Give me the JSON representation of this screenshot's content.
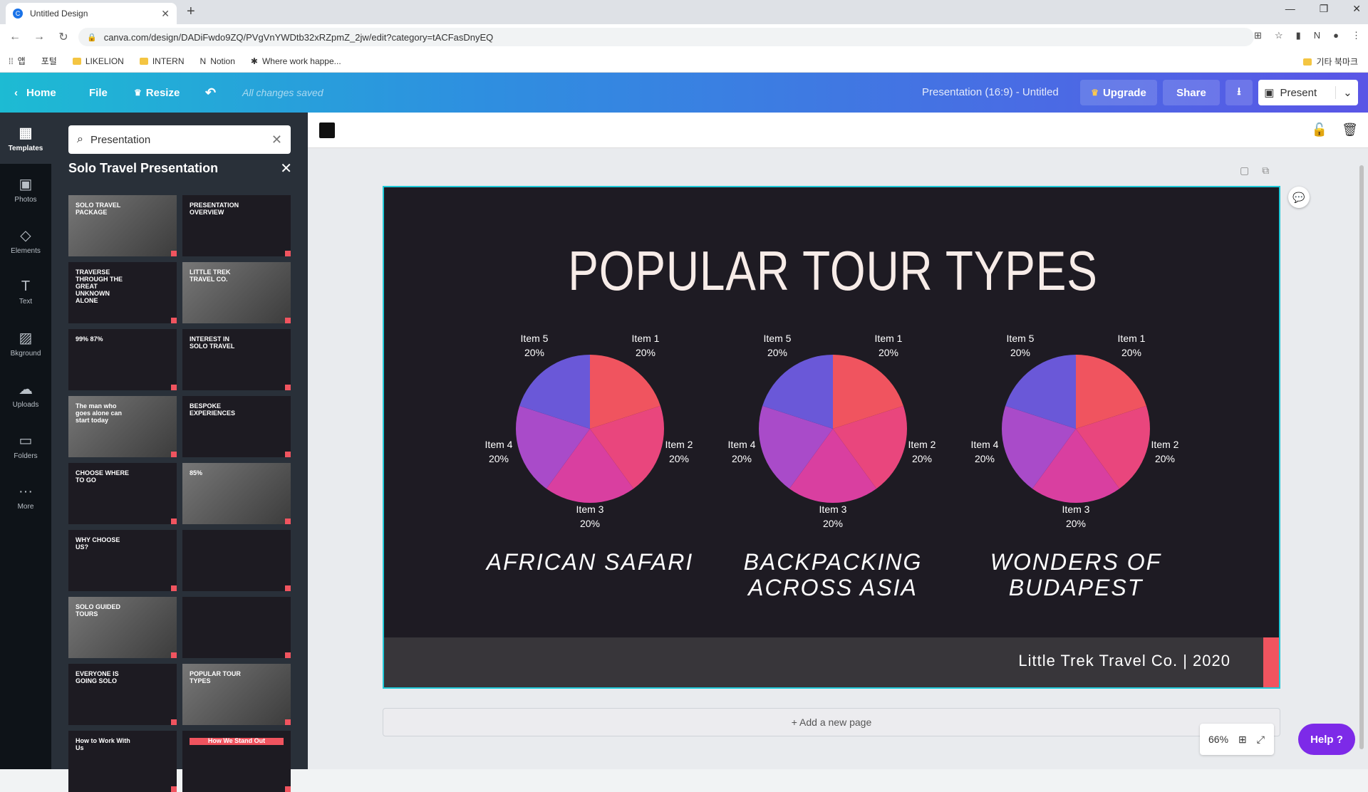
{
  "browser": {
    "tab_title": "Untitled Design",
    "url": "canva.com/design/DADiFwdo9ZQ/PVgVnYWDtb32xRZpmZ_2jw/edit?category=tACFasDnyEQ",
    "bookmarks": [
      "LIKELION",
      "INTERN",
      "Notion",
      "Where work happe..."
    ],
    "bookmark_prefix": [
      "앱",
      "포털"
    ],
    "other_bookmarks": "기타 북마크"
  },
  "topbar": {
    "home": "Home",
    "file": "File",
    "resize": "Resize",
    "saved": "All changes saved",
    "doc_title": "Presentation (16:9) - Untitled",
    "upgrade": "Upgrade",
    "share": "Share",
    "present": "Present"
  },
  "rail": [
    {
      "label": "Templates",
      "icon": "templates-icon"
    },
    {
      "label": "Photos",
      "icon": "photos-icon"
    },
    {
      "label": "Elements",
      "icon": "elements-icon"
    },
    {
      "label": "Text",
      "icon": "text-icon"
    },
    {
      "label": "Bkground",
      "icon": "background-icon"
    },
    {
      "label": "Uploads",
      "icon": "uploads-icon"
    },
    {
      "label": "Folders",
      "icon": "folders-icon"
    },
    {
      "label": "More",
      "icon": "more-icon"
    }
  ],
  "panel": {
    "search_value": "Presentation",
    "title": "Solo Travel Presentation",
    "thumbs": [
      {
        "label": "SOLO TRAVEL PACKAGE"
      },
      {
        "label": "PRESENTATION OVERVIEW"
      },
      {
        "label": "TRAVERSE THROUGH THE GREAT UNKNOWN ALONE"
      },
      {
        "label": "LITTLE TREK TRAVEL CO."
      },
      {
        "label": "99%   87%"
      },
      {
        "label": "INTEREST IN SOLO TRAVEL"
      },
      {
        "label": "The man who goes alone can start today"
      },
      {
        "label": "BESPOKE EXPERIENCES"
      },
      {
        "label": "CHOOSE WHERE TO GO"
      },
      {
        "label": "85%"
      },
      {
        "label": "WHY CHOOSE US?"
      },
      {
        "label": ""
      },
      {
        "label": "SOLO GUIDED TOURS"
      },
      {
        "label": ""
      },
      {
        "label": "EVERYONE IS GOING SOLO"
      },
      {
        "label": "POPULAR TOUR TYPES"
      },
      {
        "label": "How to Work With Us"
      },
      {
        "label": "How We Stand Out"
      }
    ]
  },
  "slide": {
    "title": "POPULAR TOUR TYPES",
    "footer": "Little Trek Travel Co. | 2020",
    "colors": {
      "bg": "#1e1b23",
      "accent": "#f0545f"
    },
    "pie_labels": [
      {
        "name": "Item 1",
        "pct": "20%"
      },
      {
        "name": "Item 2",
        "pct": "20%"
      },
      {
        "name": "Item 3",
        "pct": "20%"
      },
      {
        "name": "Item 4",
        "pct": "20%"
      },
      {
        "name": "Item 5",
        "pct": "20%"
      }
    ],
    "captions": [
      "AFRICAN SAFARI",
      "BACKPACKING ACROSS ASIA",
      "WONDERS OF BUDAPEST"
    ]
  },
  "chart_data": [
    {
      "type": "pie",
      "categories": [
        "Item 1",
        "Item 2",
        "Item 3",
        "Item 4",
        "Item 5"
      ],
      "values": [
        20,
        20,
        20,
        20,
        20
      ],
      "title": "AFRICAN SAFARI"
    },
    {
      "type": "pie",
      "categories": [
        "Item 1",
        "Item 2",
        "Item 3",
        "Item 4",
        "Item 5"
      ],
      "values": [
        20,
        20,
        20,
        20,
        20
      ],
      "title": "BACKPACKING ACROSS ASIA"
    },
    {
      "type": "pie",
      "categories": [
        "Item 1",
        "Item 2",
        "Item 3",
        "Item 4",
        "Item 5"
      ],
      "values": [
        20,
        20,
        20,
        20,
        20
      ],
      "title": "WONDERS OF BUDAPEST"
    }
  ],
  "bottom": {
    "add_page": "+ Add a new page",
    "zoom": "66%",
    "help": "Help ?"
  }
}
